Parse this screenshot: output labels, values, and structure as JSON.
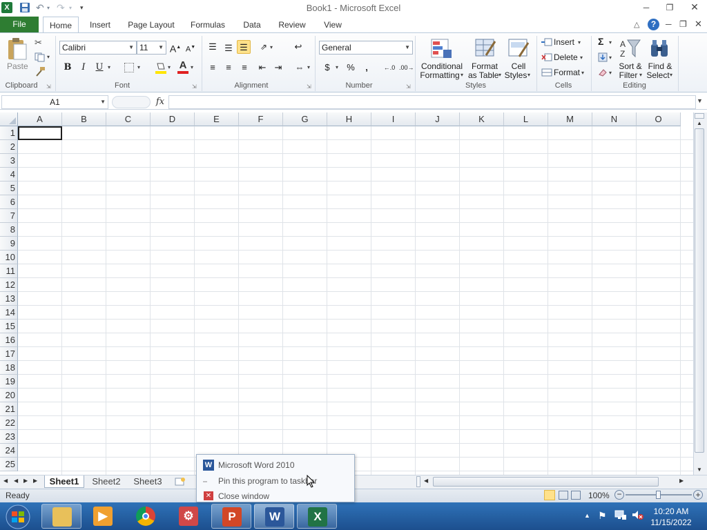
{
  "window": {
    "title": "Book1  -  Microsoft Excel",
    "min_icon": "minimize-icon",
    "max_icon": "restore-icon",
    "close_icon": "close-icon"
  },
  "tabs": {
    "file": "File",
    "items": [
      "Home",
      "Insert",
      "Page Layout",
      "Formulas",
      "Data",
      "Review",
      "View"
    ],
    "active": "Home"
  },
  "ribbon": {
    "clipboard": {
      "paste": "Paste",
      "label": "Clipboard"
    },
    "font": {
      "name": "Calibri",
      "size": "11",
      "bold": "B",
      "italic": "I",
      "underline": "U",
      "label": "Font"
    },
    "alignment": {
      "label": "Alignment"
    },
    "number": {
      "format": "General",
      "currency": "$",
      "percent": "%",
      "comma": ",",
      "label": "Number"
    },
    "styles": {
      "conditional_line1": "Conditional",
      "conditional_line2": "Formatting",
      "format_table_line1": "Format",
      "format_table_line2": "as Table",
      "cell_styles_line1": "Cell",
      "cell_styles_line2": "Styles",
      "label": "Styles"
    },
    "cells": {
      "insert": "Insert",
      "delete": "Delete",
      "format": "Format",
      "label": "Cells"
    },
    "editing": {
      "sum": "Σ",
      "sort_line1": "Sort &",
      "sort_line2": "Filter",
      "find_line1": "Find &",
      "find_line2": "Select",
      "label": "Editing"
    }
  },
  "formula_bar": {
    "name_box": "A1",
    "fx": "fx",
    "value": ""
  },
  "grid": {
    "columns": [
      "A",
      "B",
      "C",
      "D",
      "E",
      "F",
      "G",
      "H",
      "I",
      "J",
      "K",
      "L",
      "M",
      "N",
      "O"
    ],
    "rows": [
      "1",
      "2",
      "3",
      "4",
      "5",
      "6",
      "7",
      "8",
      "9",
      "10",
      "11",
      "12",
      "13",
      "14",
      "15",
      "16",
      "17",
      "18",
      "19",
      "20",
      "21",
      "22",
      "23",
      "24",
      "25"
    ]
  },
  "sheets": {
    "tabs": [
      "Sheet1",
      "Sheet2",
      "Sheet3"
    ],
    "active": "Sheet1"
  },
  "status": {
    "ready": "Ready",
    "zoom": "100%"
  },
  "jump_list": {
    "app": "Microsoft Word 2010",
    "pin": "Pin this program to taskbar",
    "close": "Close window"
  },
  "taskbar": {
    "items": [
      "start-orb",
      "windows-explorer",
      "media-player",
      "google-chrome",
      "office-tools",
      "microsoft-powerpoint",
      "microsoft-word",
      "microsoft-excel"
    ],
    "time": "10:20 AM",
    "date": "11/15/2022"
  }
}
